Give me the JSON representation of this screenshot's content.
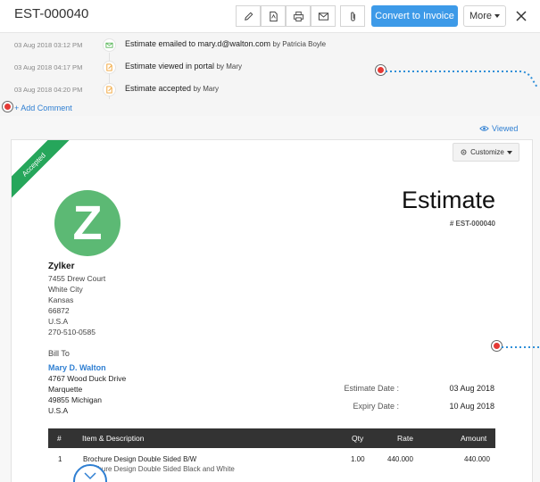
{
  "header": {
    "estimate_id": "EST-000040",
    "convert_label": "Convert to Invoice",
    "more_label": "More"
  },
  "activity": [
    {
      "time": "03 Aug 2018 03:12 PM",
      "text": "Estimate emailed to mary.d@walton.com",
      "by": "by Patricia Boyle",
      "icon": "mail-icon",
      "color": "#5cb85c"
    },
    {
      "time": "03 Aug 2018 04:17 PM",
      "text": "Estimate viewed in portal",
      "by": "by Mary",
      "icon": "document-icon",
      "color": "#f0a030"
    },
    {
      "time": "03 Aug 2018 04:20 PM",
      "text": "Estimate accepted",
      "by": "by Mary",
      "icon": "document-icon",
      "color": "#f0a030"
    }
  ],
  "add_comment": "+ Add Comment",
  "viewed_label": "Viewed",
  "customize_label": "Customize",
  "ribbon_label": "Accepted",
  "document": {
    "logo_letter": "Z",
    "title": "Estimate",
    "number": "# EST-000040",
    "org": {
      "name": "Zylker",
      "lines": [
        "7455 Drew Court",
        "White City",
        "Kansas",
        "66872",
        "U.S.A",
        "270-510-0585"
      ]
    },
    "bill_to_label": "Bill To",
    "bill_to": {
      "name": "Mary D. Walton",
      "lines": [
        "4767 Wood Duck Drive",
        "Marquette",
        "49855 Michigan",
        "U.S.A"
      ]
    },
    "meta": [
      {
        "label": "Estimate Date :",
        "value": "03 Aug 2018"
      },
      {
        "label": "Expiry Date :",
        "value": "10 Aug 2018"
      }
    ],
    "table": {
      "headers": {
        "num": "#",
        "item": "Item & Description",
        "qty": "Qty",
        "rate": "Rate",
        "amount": "Amount"
      },
      "rows": [
        {
          "num": "1",
          "item": "Brochure Design Double Sided B/W",
          "desc": "Brochure Design Double Sided Black and White",
          "qty": "1.00",
          "rate": "440.000",
          "amount": "440.000"
        }
      ]
    }
  },
  "colors": {
    "accent": "#3d9ae8",
    "accepted": "#26a65b",
    "logo": "#5cb974",
    "table_header": "#333333",
    "annotation": "#e53935"
  }
}
